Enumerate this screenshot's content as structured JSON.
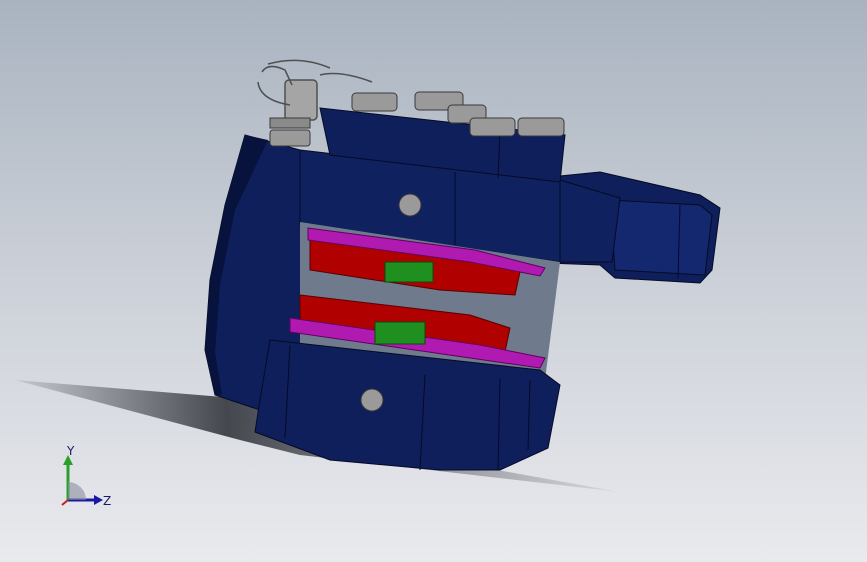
{
  "viewport": {
    "background_top": "#a9b3c0",
    "background_bottom": "#e9eaee"
  },
  "model": {
    "body_color": "#0f1f5c",
    "body_dark": "#07123d",
    "pad_color": "#b00000",
    "shim_color": "#b01ab0",
    "piston_color": "#1f8f1f",
    "bolt_color": "#9a9a9a"
  },
  "triad": {
    "y_label": "Y",
    "z_label": "Z",
    "y_color": "#2aa02a",
    "z_color": "#1a1aa0",
    "x_color": "#c02020"
  }
}
